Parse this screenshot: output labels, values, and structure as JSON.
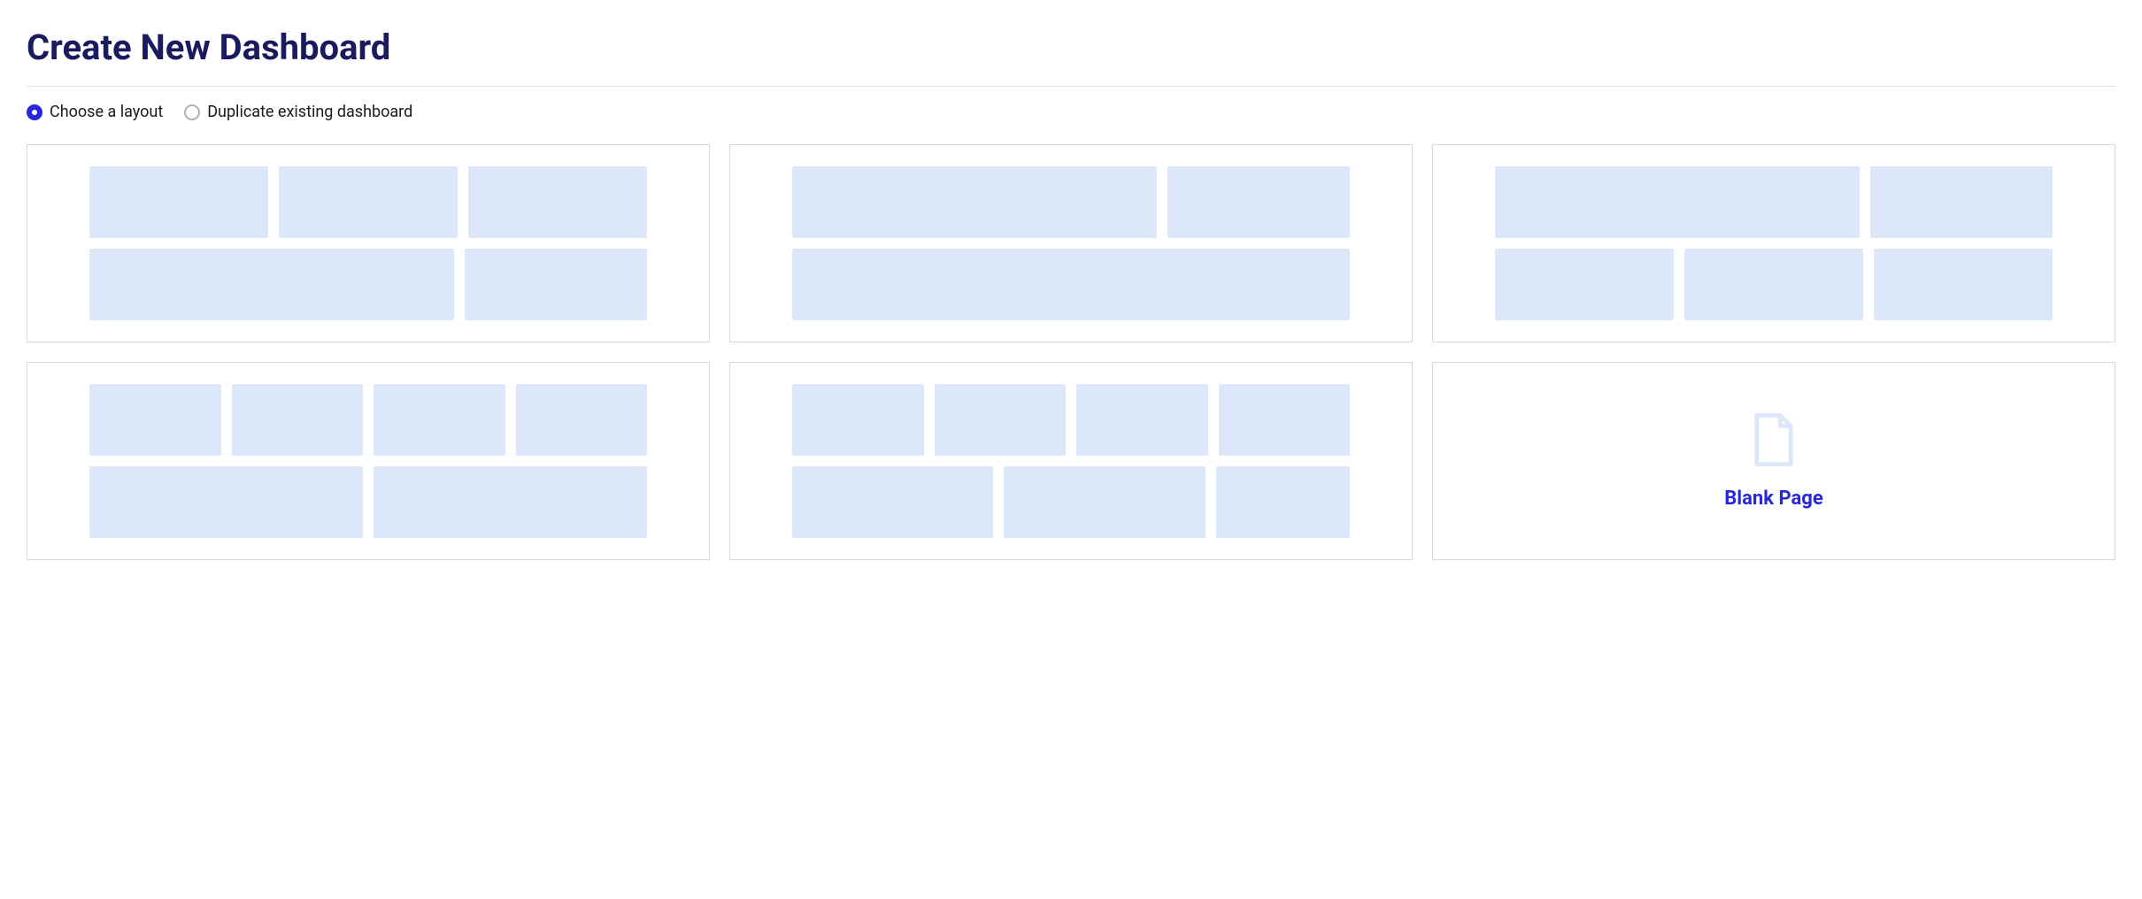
{
  "page": {
    "title": "Create New Dashboard"
  },
  "options": {
    "choose_layout": "Choose a layout",
    "duplicate_dashboard": "Duplicate existing dashboard",
    "selected": "choose_layout"
  },
  "layouts": {
    "blank_label": "Blank Page"
  },
  "colors": {
    "accent": "#2828d8",
    "title": "#1a1a5e",
    "block": "#dde7fa",
    "border": "#d8d8d8"
  }
}
